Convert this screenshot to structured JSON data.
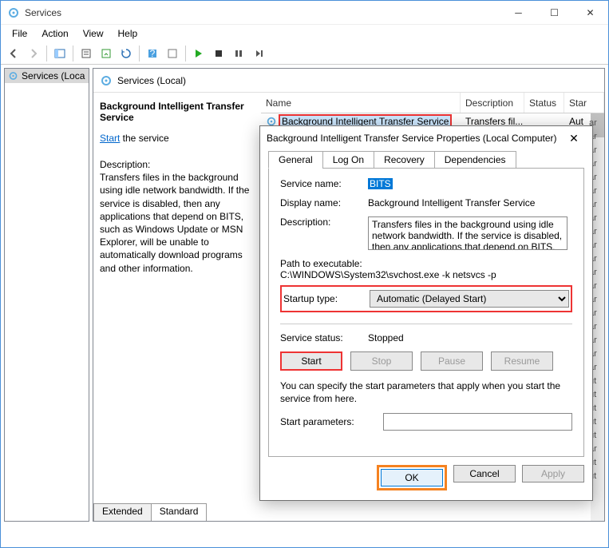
{
  "window": {
    "title": "Services"
  },
  "menu": {
    "file": "File",
    "action": "Action",
    "view": "View",
    "help": "Help"
  },
  "tree": {
    "root": "Services (Local)"
  },
  "header": {
    "title": "Services (Local)"
  },
  "detail": {
    "title": "Background Intelligent Transfer Service",
    "startLink": "Start",
    "startSuffix": " the service",
    "descLabel": "Description:",
    "descText": "Transfers files in the background using idle network bandwidth. If the service is disabled, then any applications that depend on BITS, such as Windows Update or MSN Explorer, will be unable to automatically download programs and other information."
  },
  "columns": {
    "name": "Name",
    "description": "Description",
    "status": "Status",
    "startup": "Star"
  },
  "row": {
    "name": "Background Intelligent Transfer Service",
    "desc": "Transfers fil...",
    "status": "",
    "startup": "Aut"
  },
  "sideList": [
    "ar",
    "ar",
    "ar",
    "ar",
    "ar",
    "ar",
    "ar",
    "ar",
    "ar",
    "ar",
    "ar",
    "ar",
    "ar",
    "ar",
    "ar",
    "ar",
    "ar",
    "ar",
    "ar",
    "ut",
    "ut",
    "ut",
    "ut",
    "ut",
    "ar",
    "ut",
    "ut"
  ],
  "tabs": {
    "extended": "Extended",
    "standard": "Standard"
  },
  "dlg": {
    "title": "Background Intelligent Transfer Service Properties (Local Computer)",
    "tabs": {
      "general": "General",
      "logon": "Log On",
      "recovery": "Recovery",
      "deps": "Dependencies"
    },
    "serviceNameLbl": "Service name:",
    "serviceName": "BITS",
    "displayNameLbl": "Display name:",
    "displayName": "Background Intelligent Transfer Service",
    "descLbl": "Description:",
    "descVal": "Transfers files in the background using idle network bandwidth. If the service is disabled, then any applications that depend on BITS, such as Windows",
    "pathLbl": "Path to executable:",
    "pathVal": "C:\\WINDOWS\\System32\\svchost.exe -k netsvcs -p",
    "startupLbl": "Startup type:",
    "startupVal": "Automatic (Delayed Start)",
    "statusLbl": "Service status:",
    "statusVal": "Stopped",
    "btnStart": "Start",
    "btnStop": "Stop",
    "btnPause": "Pause",
    "btnResume": "Resume",
    "hint": "You can specify the start parameters that apply when you start the service from here.",
    "startParamsLbl": "Start parameters:",
    "ok": "OK",
    "cancel": "Cancel",
    "apply": "Apply"
  }
}
